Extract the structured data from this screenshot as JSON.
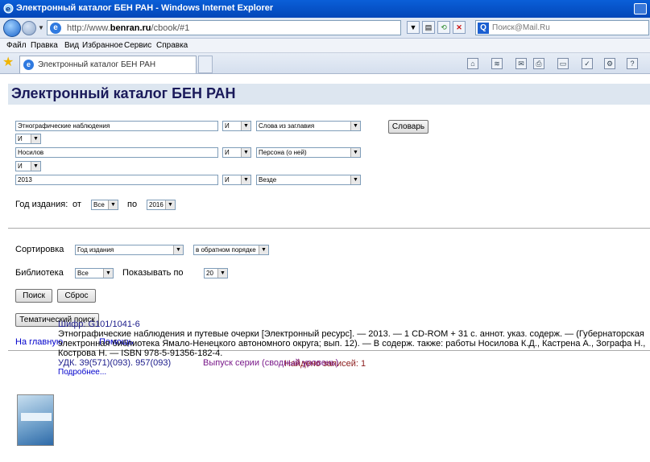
{
  "window": {
    "title": "Электронный каталог БЕН РАН - Windows Internet Explorer"
  },
  "address_bar": {
    "url_prefix": "http://www.",
    "url_domain": "benran.ru",
    "url_suffix": "/cbook/#1",
    "search_placeholder": "Поиск@Mail.Ru"
  },
  "menu": [
    "Файл",
    "Правка",
    "Вид",
    "Избранное",
    "Сервис",
    "Справка"
  ],
  "tab": {
    "label": "Электронный каталог БЕН РАН"
  },
  "page": {
    "heading": "Электронный каталог БЕН РАН",
    "query_rows": [
      {
        "value": "Этнографические наблюдения",
        "op": "И",
        "field": "Слова из заглавия"
      },
      {
        "value": "Носилов",
        "op": "И",
        "field": "Персона (о ней)"
      },
      {
        "value": "2013",
        "op": "И",
        "field": "Везде"
      }
    ],
    "between_ops": [
      "И",
      "И"
    ],
    "dictionary_button": "Словарь",
    "year_label": "Год издания:",
    "year_from_label": "от",
    "year_from": "Все",
    "year_to_label": "по",
    "year_to": "2016",
    "sort_label": "Сортировка",
    "sort_by": "Год издания",
    "sort_order": "в обратном порядке",
    "library_label": "Библиотека",
    "library_value": "Все",
    "show_label": "Показывать по",
    "show_value": "20",
    "search_button": "Поиск",
    "reset_button": "Сброс",
    "thematic_button": "Тематический поиск",
    "home_link": "На главную",
    "help_link": "Помощь",
    "found_text": "Найдено записей: 1"
  },
  "record": {
    "cipher": "Шифр: G101/1041-6",
    "description": "Этнографические наблюдения и путевые очерки [Электронный ресурс]. — 2013. — 1 CD-ROM + 31 с. аннот. указ. содерж. — (Губернаторская электронная библиотека Ямало-Ненецкого автономного округа; вып. 12). — В содерж. также: работы Носилова К.Д., Кастрена А., Зографа Н., Кострова Н. — ISBN 978-5-91356-182-4.",
    "udk": "УДК. 39(571)(093). 957(093)",
    "series": "Выпуск серии (сводный уровень)",
    "more": "Подробнее..."
  },
  "colors": {
    "titlebar": "#0a5fd8",
    "heading_bg": "#dde6f0",
    "heading_text": "#1a1a5a",
    "found_text": "#8a1a1a",
    "link": "#0000cc"
  }
}
